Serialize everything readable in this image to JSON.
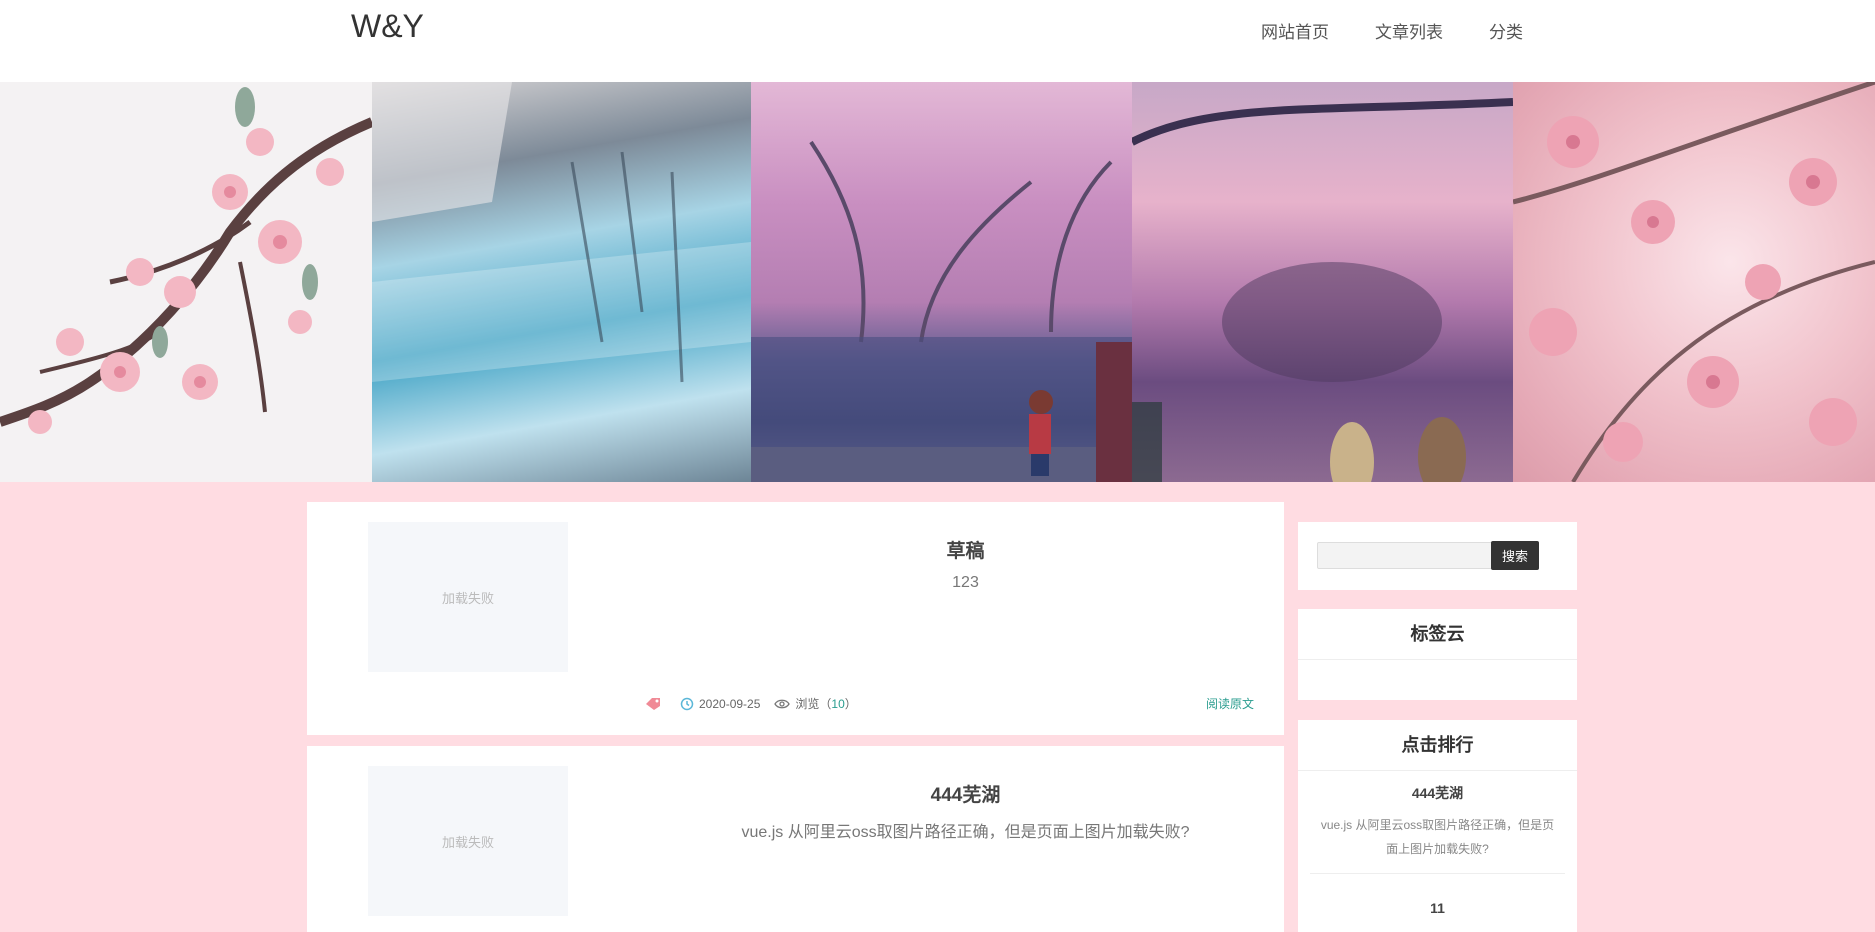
{
  "site": {
    "logo": "W&Y"
  },
  "nav": {
    "items": [
      {
        "label": "网站首页"
      },
      {
        "label": "文章列表"
      },
      {
        "label": "分类"
      }
    ]
  },
  "articles": [
    {
      "title": "草稿",
      "desc": "123",
      "thumb": "加载失败",
      "date": "2020-09-25",
      "views_label": "浏览",
      "views": "10",
      "read_more": "阅读原文"
    },
    {
      "title": "444芜湖",
      "desc": "vue.js 从阿里云oss取图片路径正确，但是页面上图片加载失败?",
      "thumb": "加载失败"
    }
  ],
  "sidebar": {
    "search": {
      "button": "搜索",
      "placeholder": ""
    },
    "tags": {
      "title": "标签云"
    },
    "rank": {
      "title": "点击排行",
      "items": [
        {
          "title": "444芜湖",
          "desc": "vue.js 从阿里云oss取图片路径正确，但是页面上图片加载失败?"
        },
        {
          "title": "11"
        }
      ]
    }
  },
  "icons": {
    "tag": "tag-icon",
    "history": "history-icon",
    "eye": "eye-icon"
  },
  "colors": {
    "bg": "#ffdce2",
    "accent": "#2a9d8f",
    "tag_icon": "#f08a96",
    "history_icon": "#5bb7d8"
  }
}
